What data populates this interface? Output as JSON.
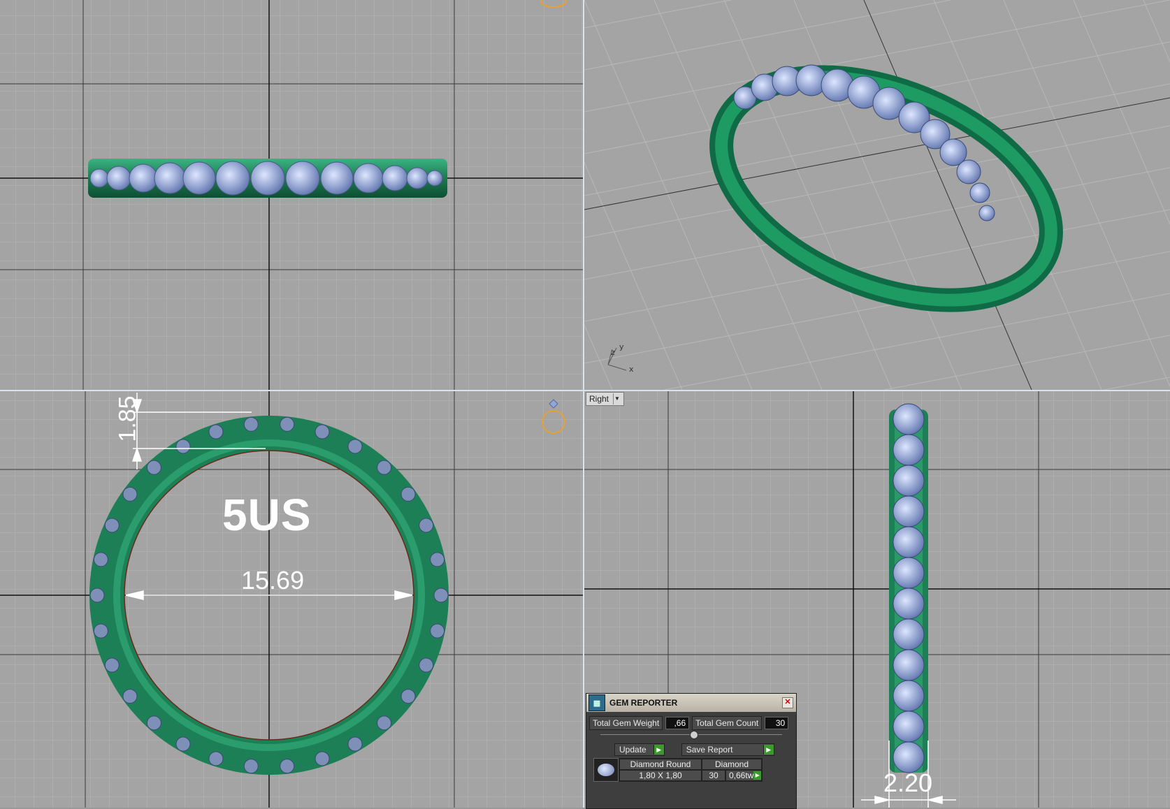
{
  "viewports": {
    "front": {
      "name": ""
    },
    "perspective": {
      "axis_y": "y",
      "axis_x": "x",
      "axis_z": "z"
    },
    "top": {
      "name": ""
    },
    "right": {
      "name": "Right"
    }
  },
  "annotations": {
    "ring_size": "5US",
    "inner_diameter": "15.69",
    "band_thickness": "1.85",
    "band_width": "2.20"
  },
  "gem_reporter": {
    "title": "GEM REPORTER",
    "total_gem_weight_label": "Total Gem Weight",
    "total_gem_weight_value": ",66",
    "total_gem_count_label": "Total Gem Count",
    "total_gem_count_value": "30",
    "update_label": "Update",
    "save_report_label": "Save Report",
    "gem": {
      "shape": "Diamond Round",
      "material": "Diamond",
      "size": "1,80 X 1,80",
      "count": "30",
      "weight": "0,66tw"
    }
  },
  "colors": {
    "metal": "#1f8a5a",
    "gem": "#8ea6d8",
    "grid_minor": "#b7b7b7",
    "grid_major": "#3a3a3a",
    "viewport_bg": "#a4a4a4",
    "gizmo": "#e8a030"
  }
}
